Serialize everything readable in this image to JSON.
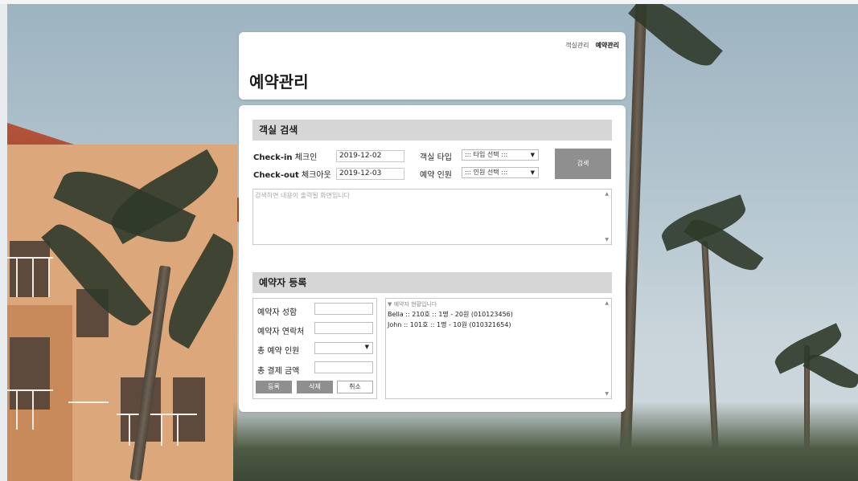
{
  "header": {
    "title": "예약관리",
    "nav": [
      "객실관리",
      "예약관리"
    ]
  },
  "room_search": {
    "title": "객실 검색",
    "checkin_label_en": "Check-in",
    "checkin_label_ko": "체크인",
    "checkin_value": "2019-12-02",
    "checkout_label_en": "Check-out",
    "checkout_label_ko": "체크아웃",
    "checkout_value": "2019-12-03",
    "room_type_label": "객실 타입",
    "room_type_value": "::: 타입 선택 :::",
    "guests_label": "예약 인원",
    "guests_value": "::: 인원 선택 :::",
    "search_button": "검색",
    "result_placeholder": "검색하면 내용이 출력될 화면입니다"
  },
  "registration": {
    "title": "예약자 등록",
    "name_label": "예약자 성함",
    "phone_label": "예약자 연락처",
    "guests_label": "총 예약 인원",
    "payment_label": "총 결제 금액",
    "register_button": "등록",
    "delete_button": "삭제",
    "cancel_button": "취소",
    "list_header": "▼ 예약자 현황입니다",
    "reservations": [
      "Bella :: 210호 :: 1명 - 20원 (010123456)",
      "John :: 101호 :: 1명 - 10원 (010321654)"
    ]
  },
  "icons": {
    "dropdown": "dropdown-arrow-icon",
    "scroll_up": "scroll-up-icon",
    "scroll_down": "scroll-down-icon"
  },
  "colors": {
    "section_bar": "#d6d6d6",
    "button_gray": "#8f8f8f",
    "panel": "#ffffff"
  }
}
